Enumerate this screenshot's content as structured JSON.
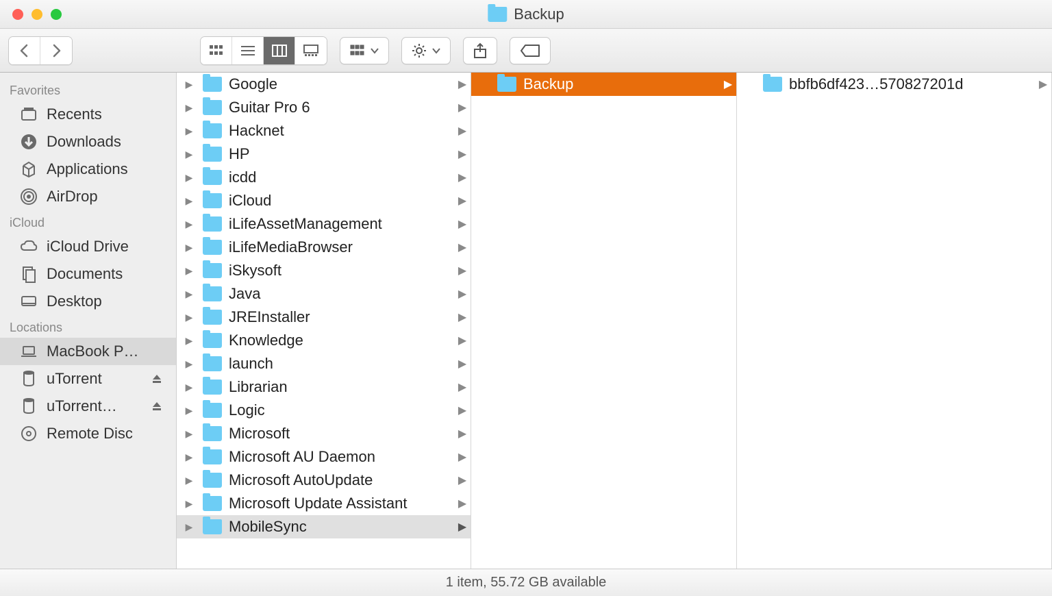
{
  "window": {
    "title": "Backup"
  },
  "sidebar": {
    "sections": [
      {
        "header": "Favorites",
        "items": [
          {
            "icon": "recents",
            "label": "Recents"
          },
          {
            "icon": "downloads",
            "label": "Downloads"
          },
          {
            "icon": "applications",
            "label": "Applications"
          },
          {
            "icon": "airdrop",
            "label": "AirDrop"
          }
        ]
      },
      {
        "header": "iCloud",
        "items": [
          {
            "icon": "icloud",
            "label": "iCloud Drive"
          },
          {
            "icon": "documents",
            "label": "Documents"
          },
          {
            "icon": "desktop",
            "label": "Desktop"
          }
        ]
      },
      {
        "header": "Locations",
        "items": [
          {
            "icon": "laptop",
            "label": "MacBook P…",
            "selected": true
          },
          {
            "icon": "disk",
            "label": "uTorrent",
            "eject": true
          },
          {
            "icon": "disk",
            "label": "uTorrent…",
            "eject": true
          },
          {
            "icon": "disc",
            "label": "Remote Disc"
          }
        ]
      }
    ]
  },
  "columns": {
    "col1": [
      {
        "label": "Google"
      },
      {
        "label": "Guitar Pro 6"
      },
      {
        "label": "Hacknet"
      },
      {
        "label": "HP",
        "pathNear": true
      },
      {
        "label": "icdd"
      },
      {
        "label": "iCloud"
      },
      {
        "label": "iLifeAssetManagement"
      },
      {
        "label": "iLifeMediaBrowser"
      },
      {
        "label": "iSkysoft"
      },
      {
        "label": "Java"
      },
      {
        "label": "JREInstaller"
      },
      {
        "label": "Knowledge"
      },
      {
        "label": "launch"
      },
      {
        "label": "Librarian"
      },
      {
        "label": "Logic"
      },
      {
        "label": "Microsoft"
      },
      {
        "label": "Microsoft AU Daemon"
      },
      {
        "label": "Microsoft AutoUpdate"
      },
      {
        "label": "Microsoft Update Assistant"
      },
      {
        "label": "MobileSync",
        "path": true
      }
    ],
    "col2": [
      {
        "label": "Backup",
        "selected": true
      }
    ],
    "col3": [
      {
        "label": "bbfb6df423…570827201d"
      }
    ]
  },
  "status": "1 item, 55.72 GB available"
}
